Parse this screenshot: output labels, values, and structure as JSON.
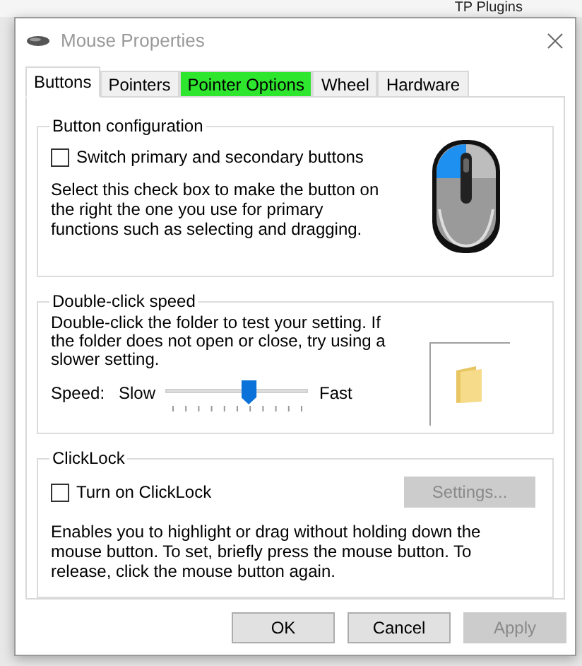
{
  "background": {
    "toolbar_label": "TP Plugins"
  },
  "window": {
    "title": "Mouse Properties"
  },
  "tabs": [
    {
      "label": "Buttons",
      "selected": true,
      "highlighted": false
    },
    {
      "label": "Pointers",
      "selected": false,
      "highlighted": false
    },
    {
      "label": "Pointer Options",
      "selected": false,
      "highlighted": true
    },
    {
      "label": "Wheel",
      "selected": false,
      "highlighted": false
    },
    {
      "label": "Hardware",
      "selected": false,
      "highlighted": false
    }
  ],
  "button_configuration": {
    "title": "Button configuration",
    "checkbox": {
      "label": "Switch primary and secondary buttons",
      "checked": false
    },
    "description": "Select this check box to make the button on the right the one you use for primary functions such as selecting and dragging."
  },
  "double_click_speed": {
    "title": "Double-click speed",
    "description": "Double-click the folder to test your setting. If the folder does not open or close, try using a slower setting.",
    "speed_label": "Speed:",
    "min_label": "Slow",
    "max_label": "Fast",
    "slider": {
      "level": 0.58
    }
  },
  "clicklock": {
    "title": "ClickLock",
    "checkbox": {
      "label": "Turn on ClickLock",
      "checked": false
    },
    "settings_button": {
      "label": "Settings...",
      "disabled": true
    },
    "description": "Enables you to highlight or drag without holding down the mouse button. To set, briefly press the mouse button. To release, click the mouse button again."
  },
  "buttons": [
    {
      "label": "OK",
      "disabled": false
    },
    {
      "label": "Cancel",
      "disabled": false
    },
    {
      "label": "Apply",
      "disabled": true
    }
  ]
}
